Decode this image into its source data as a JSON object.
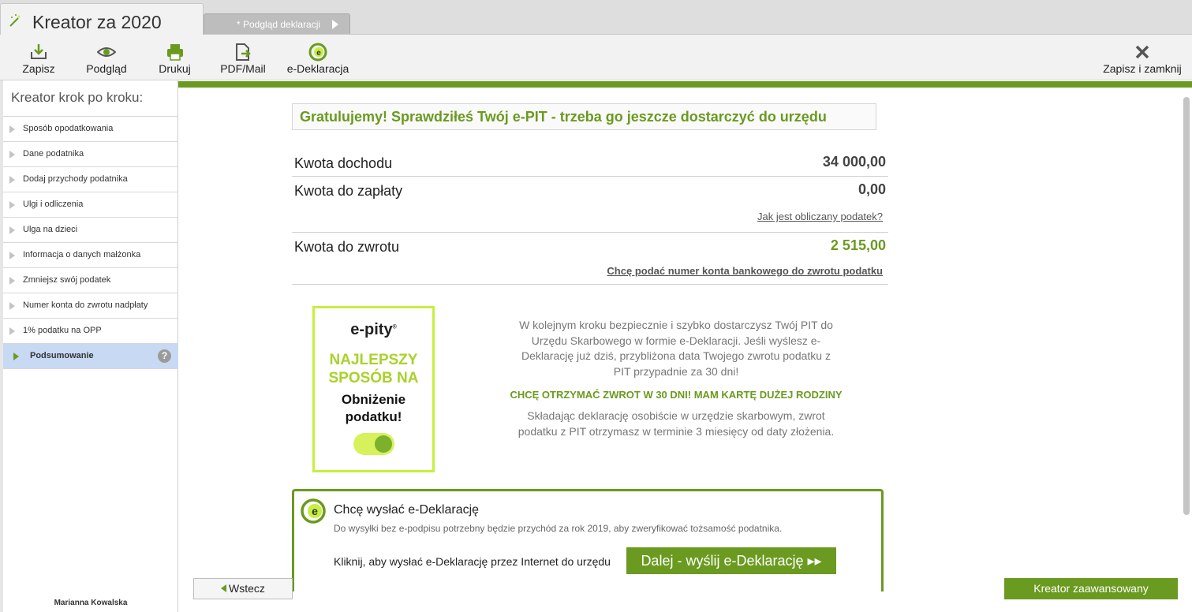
{
  "app": {
    "title": "Kreator za 2020",
    "preview_tab": "* Podgląd deklaracji"
  },
  "toolbar": {
    "save": "Zapisz",
    "preview": "Podgląd",
    "print": "Drukuj",
    "pdf_mail": "PDF/Mail",
    "edeklaracja": "e-Deklaracja",
    "save_close": "Zapisz i zamknij"
  },
  "sidebar": {
    "heading": "Kreator krok po kroku:",
    "steps": [
      "Sposób opodatkowania",
      "Dane podatnika",
      "Dodaj przychody podatnika",
      "Ulgi i odliczenia",
      "Ulga na dzieci",
      "Informacja o danych małżonka",
      "Zmniejsz swój podatek",
      "Numer konta do zwrotu nadpłaty",
      "1% podatku na OPP",
      "Podsumowanie"
    ],
    "help": "?",
    "user": "Marianna Kowalska"
  },
  "summary": {
    "headline": "Gratulujemy! Sprawdziłeś Twój e-PIT - trzeba go jeszcze dostarczyć do urzędu",
    "income_label": "Kwota dochodu",
    "income_value": "34 000,00",
    "to_pay_label": "Kwota do zapłaty",
    "to_pay_value": "0,00",
    "how_calculated": "Jak jest obliczany podatek?",
    "refund_label": "Kwota do zwrotu",
    "refund_value": "2 515,00",
    "bank_account_link": "Chcę podać numer konta bankowego do zwrotu podatku"
  },
  "promo": {
    "logo": "e-pity",
    "logo_mark": "®",
    "line1": "NAJLEPSZY",
    "line2": "SPOSÓB NA",
    "line3": "Obniżenie",
    "line4": "podatku!"
  },
  "info": {
    "paragraph1": "W kolejnym kroku bezpiecznie i szybko dostarczysz Twój PIT do Urzędu Skarbowego w formie e-Deklaracji. Jeśli wyślesz e-Deklarację już dziś, przybliżona data Twojego zwrotu podatku z PIT przypadnie za 30 dni!",
    "highlight": "CHCĘ OTRZYMAĆ ZWROT W 30 DNI! MAM KARTĘ DUŻEJ RODZINY",
    "paragraph2": "Składając deklarację osobiście w urzędzie skarbowym, zwrot podatku z PIT otrzymasz w terminie 3 miesięcy od daty złożenia."
  },
  "edeklaracja": {
    "title": "Chcę wysłać e-Deklarację",
    "subtitle": "Do wysyłki bez e-podpisu potrzebny będzie przychód za rok 2019, aby zweryfikować tożsamość podatnika.",
    "instruction": "Kliknij, aby wysłać e-Deklarację przez Internet do urzędu",
    "send_button": "Dalej - wyślij e-Deklarację ▸▸"
  },
  "nav": {
    "back": "Wstecz",
    "advanced": "Kreator zaawansowany"
  },
  "colors": {
    "brand_green": "#6a9a1f",
    "lime": "#c7ef3f",
    "active_step": "#c8d9f4"
  }
}
